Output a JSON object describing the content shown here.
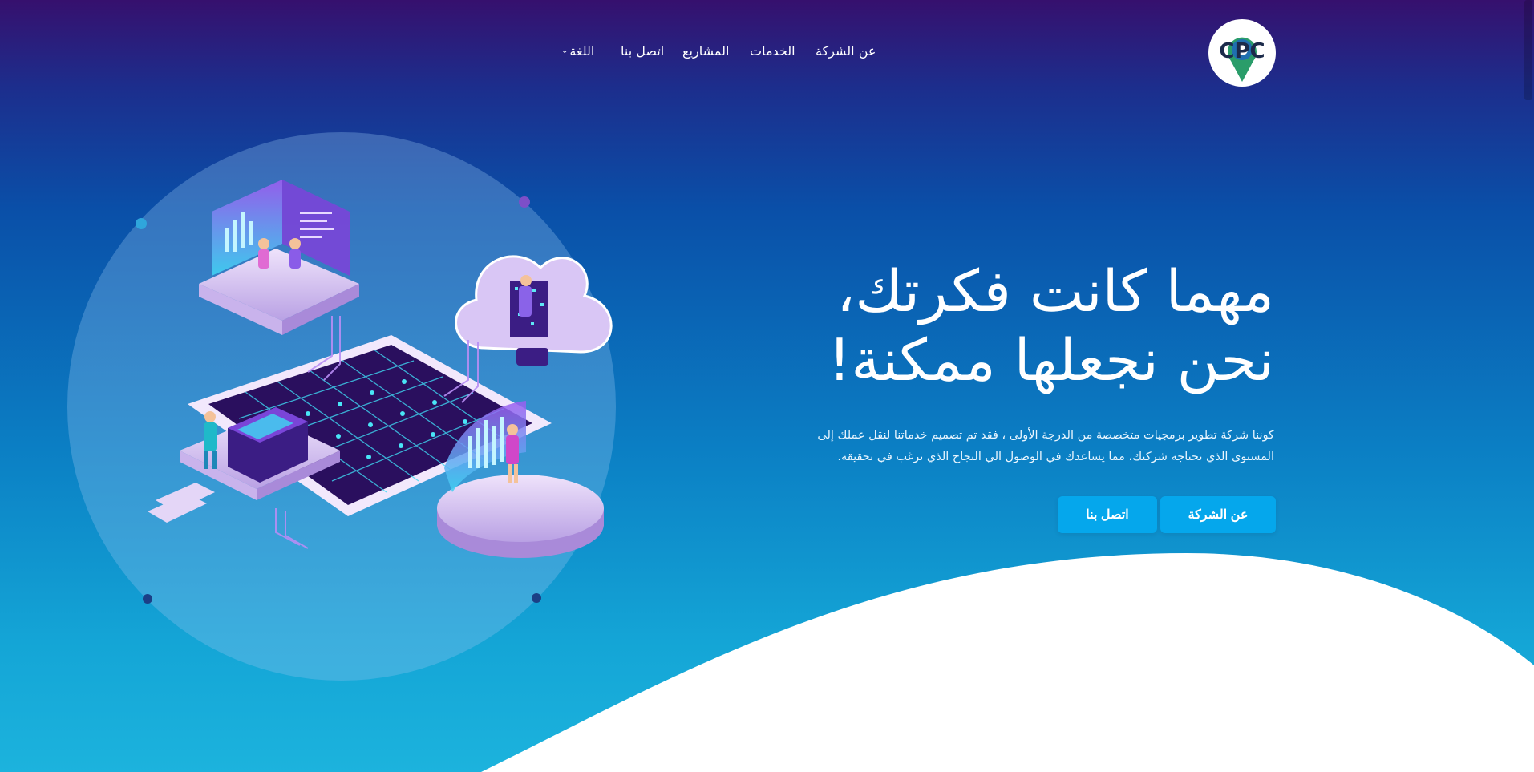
{
  "brand": {
    "logo_text": "CPC",
    "logo_icon": "map-pin-icon"
  },
  "nav": {
    "items": [
      {
        "label": "عن الشركة"
      },
      {
        "label": "الخدمات"
      },
      {
        "label": "المشاريع"
      },
      {
        "label": "اتصل بنا"
      }
    ],
    "language": {
      "label": "اللغة",
      "icon": "chevron-down-icon"
    }
  },
  "hero": {
    "headline_line1": "مهما كانت فكرتك،",
    "headline_line2": "نحن نجعلها ممكنة!",
    "description": "كوننا شركة تطوير برمجيات متخصصة من الدرجة الأولى ، فقد تم تصميم خدماتنا لنقل عملك إلى المستوى الذي تحتاجه شركتك، مما يساعدك في الوصول الي النجاح الذي ترغب في تحقيقه.",
    "buttons": {
      "about": "عن الشركة",
      "contact": "اتصل بنا"
    }
  },
  "colors": {
    "gradient_top": "#36106e",
    "gradient_mid": "#0a4fa8",
    "gradient_bottom": "#1cb3dd",
    "button": "#05a7ec",
    "wave": "#ffffff"
  }
}
